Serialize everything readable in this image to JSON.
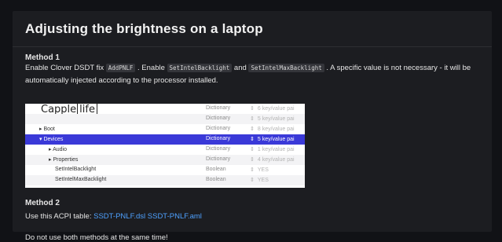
{
  "page": {
    "title": "Adjusting the brightness on a laptop"
  },
  "method1": {
    "heading": "Method 1",
    "text_a": "Enable Clover DSDT fix ",
    "code_a": "AddPNLF",
    "text_b": " . Enable ",
    "code_b": "SetIntelBacklight",
    "text_c": " and ",
    "code_c": "SetIntelMaxBacklight",
    "text_d": " . A specific value is not necessary - it will be automatically injected according to the processor installed."
  },
  "plist": {
    "logo_text": "Capple",
    "logo_box": "life",
    "rows": [
      {
        "key": "",
        "type": "Dictionary",
        "value": "6 key/value pai"
      },
      {
        "key": "",
        "type": "Dictionary",
        "value": "5 key/value pai"
      },
      {
        "key": "▸ Boot",
        "type": "Dictionary",
        "value": "8 key/value pai"
      },
      {
        "key": "▾ Devices",
        "type": "Dictionary",
        "value": "5 key/value pai"
      },
      {
        "key": "▸ Audio",
        "type": "Dictionary",
        "value": "1 key/value pai"
      },
      {
        "key": "▸ Properties",
        "type": "Dictionary",
        "value": "4 key/value pai"
      },
      {
        "key": "SetIntelBacklight",
        "type": "Boolean",
        "value": "YES"
      },
      {
        "key": "SetIntelMaxBacklight",
        "type": "Boolean",
        "value": "YES"
      }
    ]
  },
  "method2": {
    "heading": "Method 2",
    "text": "Use this ACPI table: ",
    "link1": "SSDT-PNLF.dsl",
    "link2": "SSDT-PNLF.aml"
  },
  "warning": "Do not use both methods at the same time!",
  "colors": {
    "background": "#111216",
    "panel": "#1c1d21",
    "selection": "#3a39d8",
    "link": "#4ea1ff"
  }
}
